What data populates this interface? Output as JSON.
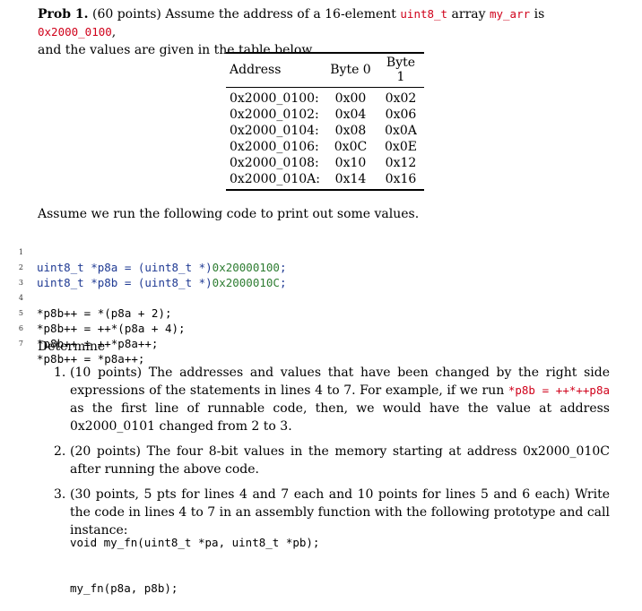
{
  "problem": {
    "title": "Prob 1.",
    "text_1": "(60 points) Assume the address of a 16-element",
    "type_code": "uint8_t",
    "text_2": "array",
    "var_code": "my_arr",
    "text_3": "is",
    "addr_code": "0x2000_0100",
    "text_4": ",",
    "text_5": "and the values are given in the table below."
  },
  "table": {
    "headers": [
      "Address",
      "Byte 0",
      "Byte 1"
    ],
    "rows": [
      [
        "0x2000_0100:",
        "0x00",
        "0x02"
      ],
      [
        "0x2000_0102:",
        "0x04",
        "0x06"
      ],
      [
        "0x2000_0104:",
        "0x08",
        "0x0A"
      ],
      [
        "0x2000_0106:",
        "0x0C",
        "0x0E"
      ],
      [
        "0x2000_0108:",
        "0x10",
        "0x12"
      ],
      [
        "0x2000_010A:",
        "0x14",
        "0x16"
      ]
    ]
  },
  "intro": "Assume we run the following code to print out some values.",
  "code": {
    "line_numbers": [
      "1",
      "2",
      "3",
      "4",
      "5",
      "6",
      "7"
    ],
    "l1_a": "uint8_t *p8a = (uint8_t *)",
    "l1_b": "0x20000100",
    "l1_c": ";",
    "l2_a": "uint8_t *p8b = (uint8_t *)",
    "l2_b": "0x2000010C",
    "l2_c": ";",
    "l4": "*p8b++ = *(p8a + 2);",
    "l5": "*p8b++ = ++*(p8a + 4);",
    "l6": "*p8b++ = ++*p8a++;",
    "l7": "*p8b++ = *p8a++;"
  },
  "determine": "Determine",
  "items": {
    "i1_num": "1.",
    "i1_a": "(10 points) The addresses and values that have been changed by the right side expressions of the statements in lines 4 to 7. For example, if we run",
    "i1_code": "*p8b = ++*++p8a",
    "i1_b": "as the first line of runnable code, then, we would have the value at address 0x2000_0101 changed from 2 to 3.",
    "i2_num": "2.",
    "i2": "(20 points) The four 8-bit values in the memory starting at address 0x2000_010C after running the above code.",
    "i3_num": "3.",
    "i3": "(30 points, 5 pts for lines 4 and 7 each and 10 points for lines 5 and 6 each) Write the code in lines 4 to 7 in an assembly function with the following prototype and call instance:"
  },
  "prototype": {
    "line1": "void my_fn(uint8_t *pa, uint8_t *pb);",
    "line2": "my_fn(p8a, p8b);"
  }
}
